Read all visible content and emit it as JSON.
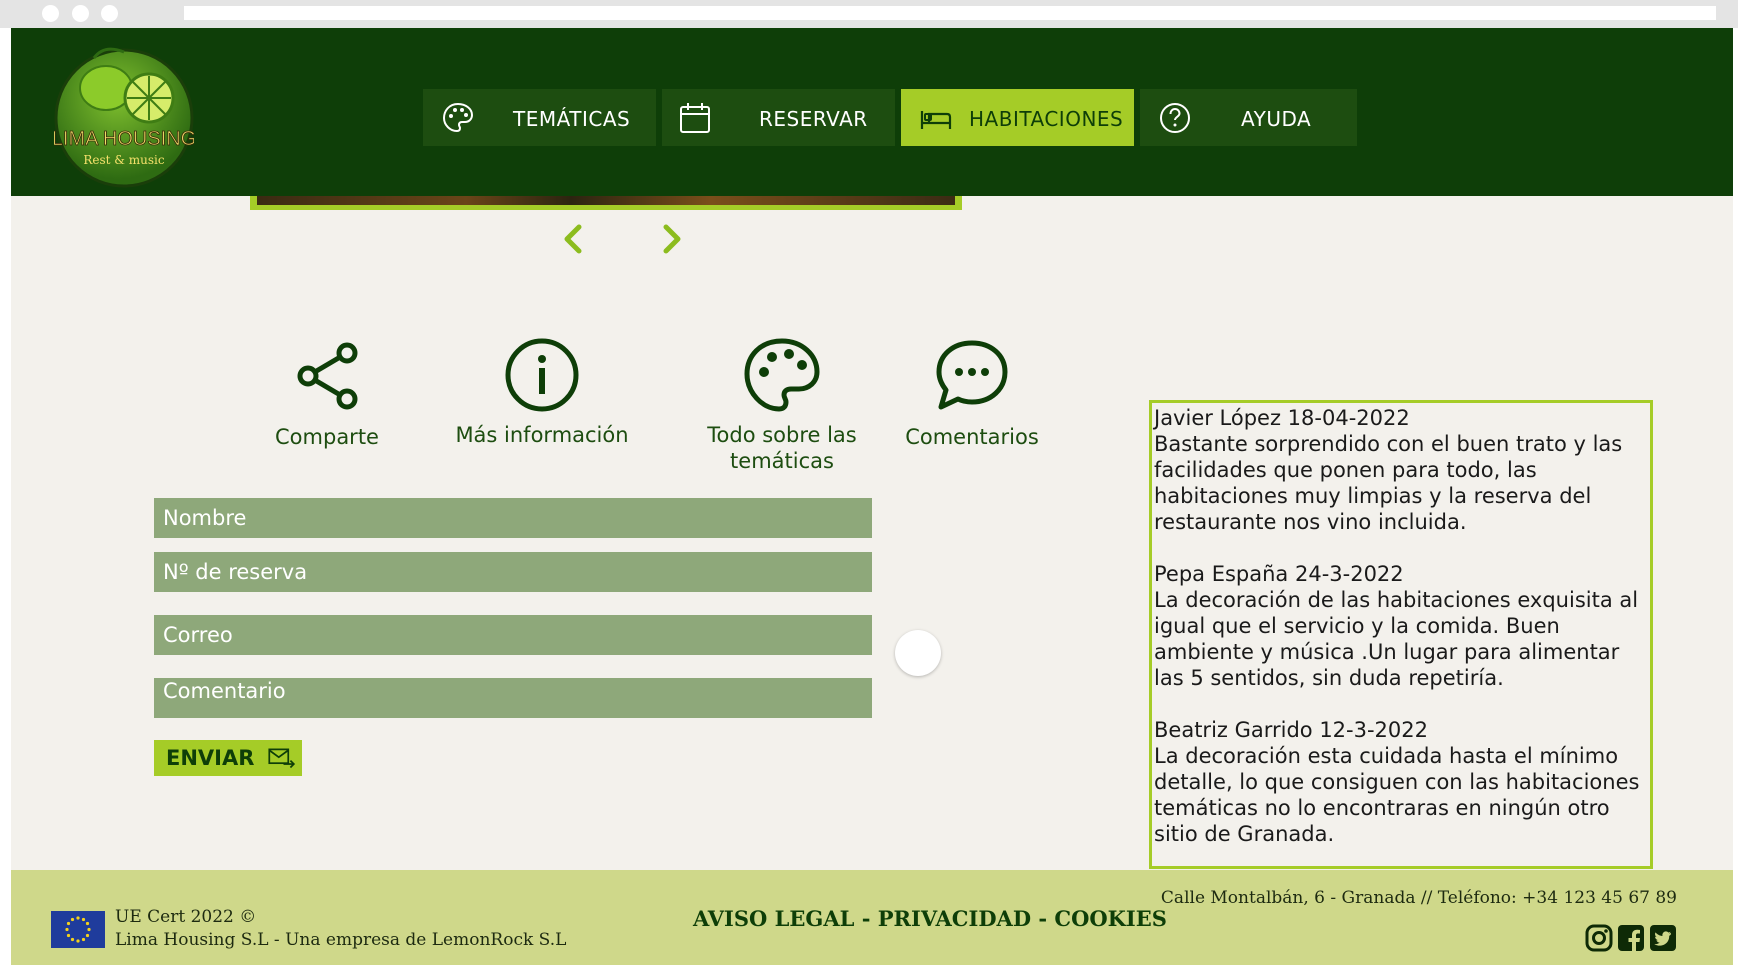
{
  "brand": {
    "name": "LIMA HOUSING",
    "tagline": "Rest & music"
  },
  "nav": [
    {
      "label": "TEMÁTICAS",
      "icon": "palette-icon"
    },
    {
      "label": "RESERVAR",
      "icon": "calendar-icon"
    },
    {
      "label": "HABITACIONES",
      "icon": "bed-icon",
      "active": true
    },
    {
      "label": "AYUDA",
      "icon": "help-icon"
    }
  ],
  "features": [
    {
      "label": "Comparte",
      "icon": "share-icon"
    },
    {
      "label": "Más información",
      "icon": "info-icon"
    },
    {
      "label": "Todo sobre las temáticas",
      "icon": "palette-icon"
    },
    {
      "label": "Comentarios",
      "icon": "comments-icon"
    }
  ],
  "form": {
    "name_placeholder": "Nombre",
    "booking_placeholder": "Nº de reserva",
    "email_placeholder": "Correo",
    "comment_placeholder": "Comentario",
    "submit_label": "ENVIAR"
  },
  "reviews": [
    {
      "author": "Javier López 18-04-2022",
      "text": "Bastante sorprendido con el buen trato y las facilidades que ponen para todo, las habitaciones muy limpias y la reserva del restaurante nos vino incluida."
    },
    {
      "author": "Pepa España 24-3-2022",
      "text": "La decoración de las habitaciones exquisita al igual que el servicio y la comida. Buen ambiente y música .Un lugar para alimentar las 5 sentidos, sin duda repetiría."
    },
    {
      "author": "Beatriz Garrido 12-3-2022",
      "text": "La decoración esta cuidada hasta el mínimo detalle, lo que consiguen con las habitaciones temáticas no lo encontraras en ningún otro sitio de Granada."
    }
  ],
  "footer": {
    "cert_line1": "UE Cert 2022 ©",
    "cert_line2": "Lima Housing S.L - Una empresa de LemonRock S.L",
    "legal": "AVISO LEGAL - PRIVACIDAD - COOKIES",
    "address": "Calle Montalbán, 6 - Granada  // Teléfono: +34 123 45 67 89",
    "social": [
      "instagram-icon",
      "facebook-icon",
      "twitter-icon"
    ]
  },
  "colors": {
    "header": "#0e3e08",
    "nav_button": "#1d4d10",
    "accent": "#a5cc27",
    "field": "#8ea87a",
    "page_bg": "#f3f1ec",
    "footer": "#cfd88a"
  }
}
